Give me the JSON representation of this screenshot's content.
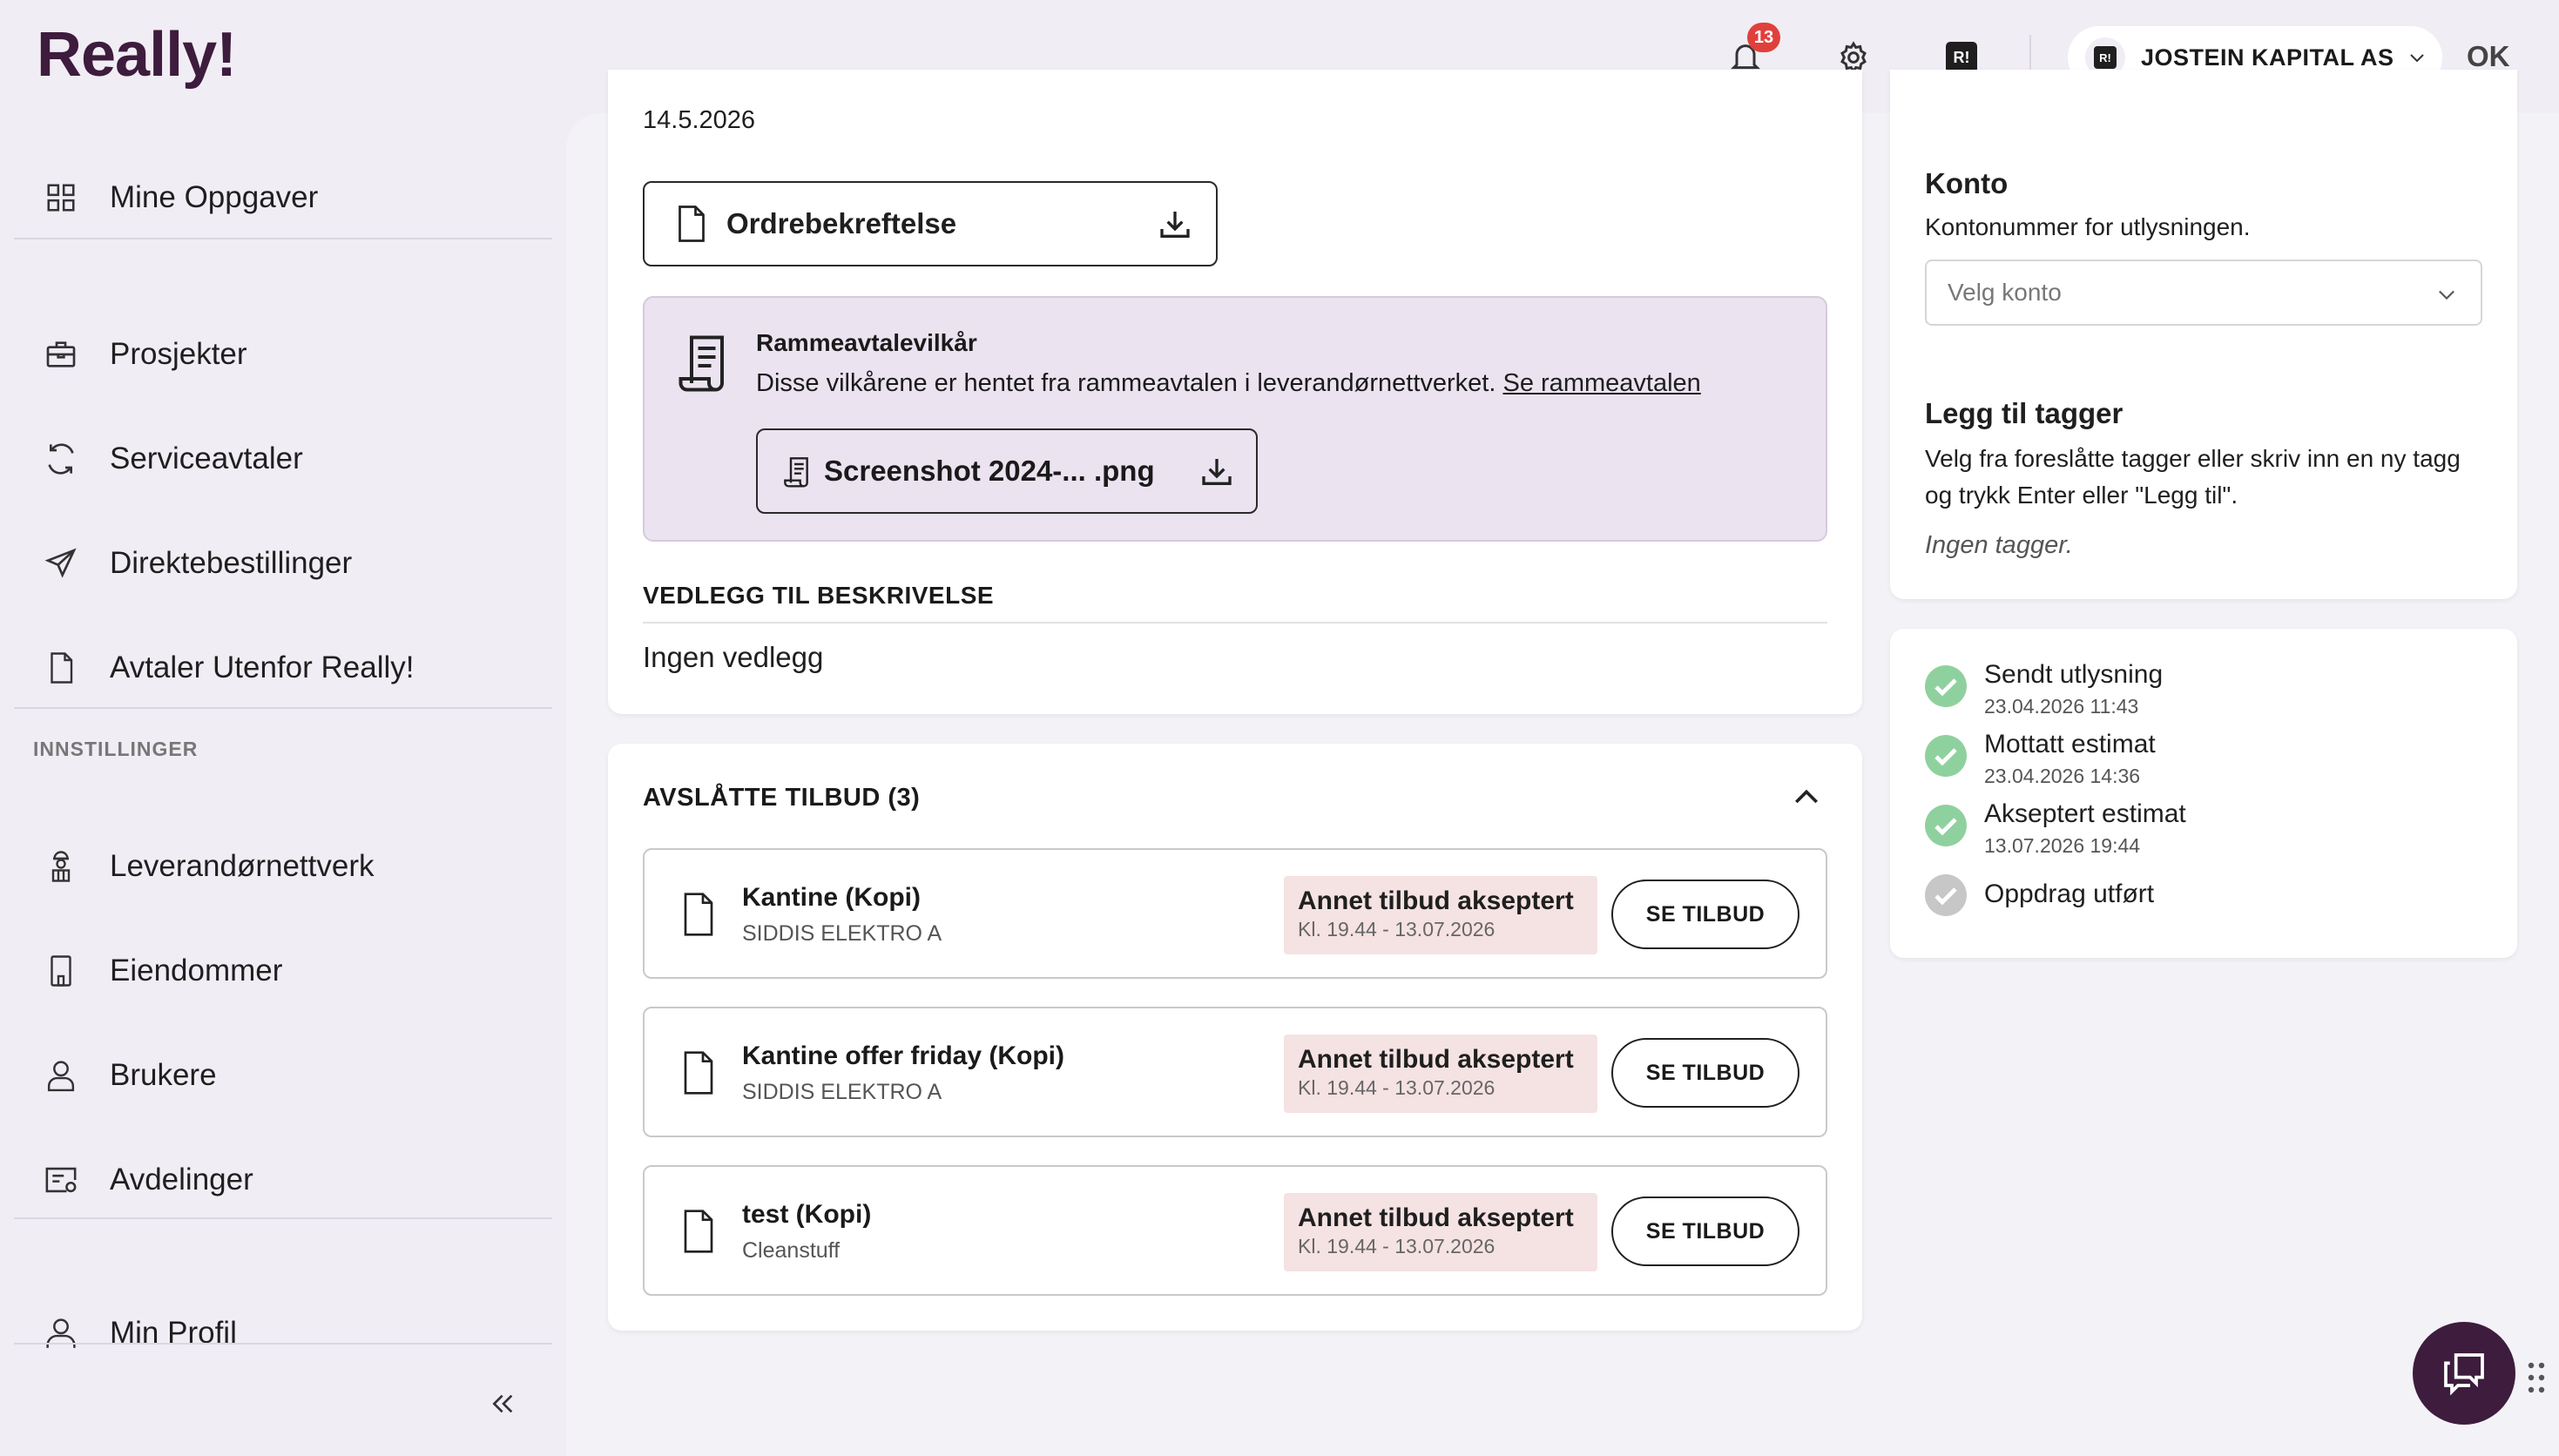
{
  "header": {
    "logo": "Really!",
    "notification_count": "13",
    "company_name": "JOSTEIN KAPITAL AS",
    "company_logo_text": "R!",
    "ok_text": "OK"
  },
  "sidebar": {
    "items": [
      {
        "label": "Mine Oppgaver",
        "icon": "grid-icon"
      },
      {
        "label": "Prosjekter",
        "icon": "briefcase-icon"
      },
      {
        "label": "Serviceavtaler",
        "icon": "refresh-icon"
      },
      {
        "label": "Direktebestillinger",
        "icon": "send-icon"
      },
      {
        "label": "Avtaler Utenfor Really!",
        "icon": "document-icon"
      }
    ],
    "settings_heading": "INNSTILLINGER",
    "settings_items": [
      {
        "label": "Leverandørnettverk",
        "icon": "worker-icon"
      },
      {
        "label": "Eiendommer",
        "icon": "building-icon"
      },
      {
        "label": "Brukere",
        "icon": "user-icon"
      },
      {
        "label": "Avdelinger",
        "icon": "department-icon"
      }
    ],
    "profile_label": "Min Profil",
    "collapse_symbol": "«"
  },
  "main": {
    "date": "14.5.2026",
    "order_confirmation_label": "Ordrebekreftelse",
    "terms": {
      "title": "Rammeavtalevilkår",
      "description": "Disse vilkårene er hentet fra rammeavtalen i leverandørnettverket.",
      "link": "Se rammeavtalen",
      "file_label": "Screenshot 2024-... .png"
    },
    "attachments_heading": "VEDLEGG TIL BESKRIVELSE",
    "attachments_empty": "Ingen vedlegg",
    "rejected": {
      "heading": "AVSLÅTTE TILBUD (3)",
      "offers": [
        {
          "name": "Kantine (Kopi)",
          "supplier": "SIDDIS ELEKTRO A",
          "status": "Annet tilbud akseptert",
          "status_time": "Kl. 19.44 - 13.07.2026",
          "button": "SE TILBUD"
        },
        {
          "name": "Kantine offer friday (Kopi)",
          "supplier": "SIDDIS ELEKTRO A",
          "status": "Annet tilbud akseptert",
          "status_time": "Kl. 19.44 - 13.07.2026",
          "button": "SE TILBUD"
        },
        {
          "name": "test (Kopi)",
          "supplier": "Cleanstuff",
          "status": "Annet tilbud akseptert",
          "status_time": "Kl. 19.44 - 13.07.2026",
          "button": "SE TILBUD"
        }
      ]
    }
  },
  "right": {
    "konto_title": "Konto",
    "konto_desc": "Kontonummer for utlysningen.",
    "konto_placeholder": "Velg konto",
    "tags_title": "Legg til tagger",
    "tags_desc": "Velg fra foreslåtte tagger eller skriv inn en ny tagg og trykk Enter eller \"Legg til\".",
    "tags_empty": "Ingen tagger.",
    "timeline": [
      {
        "label": "Sendt utlysning",
        "time": "23.04.2026 11:43",
        "done": true
      },
      {
        "label": "Mottatt estimat",
        "time": "23.04.2026 14:36",
        "done": true
      },
      {
        "label": "Akseptert estimat",
        "time": "13.07.2026 19:44",
        "done": true
      },
      {
        "label": "Oppdrag utført",
        "time": "",
        "done": false
      }
    ]
  },
  "colors": {
    "brand": "#3d1c3d",
    "badge": "#e0403c",
    "check_done": "#8fd19e",
    "check_pending": "#c7c7c7",
    "status_bg": "#f5e2e3",
    "terms_bg": "#ebe3f0"
  }
}
